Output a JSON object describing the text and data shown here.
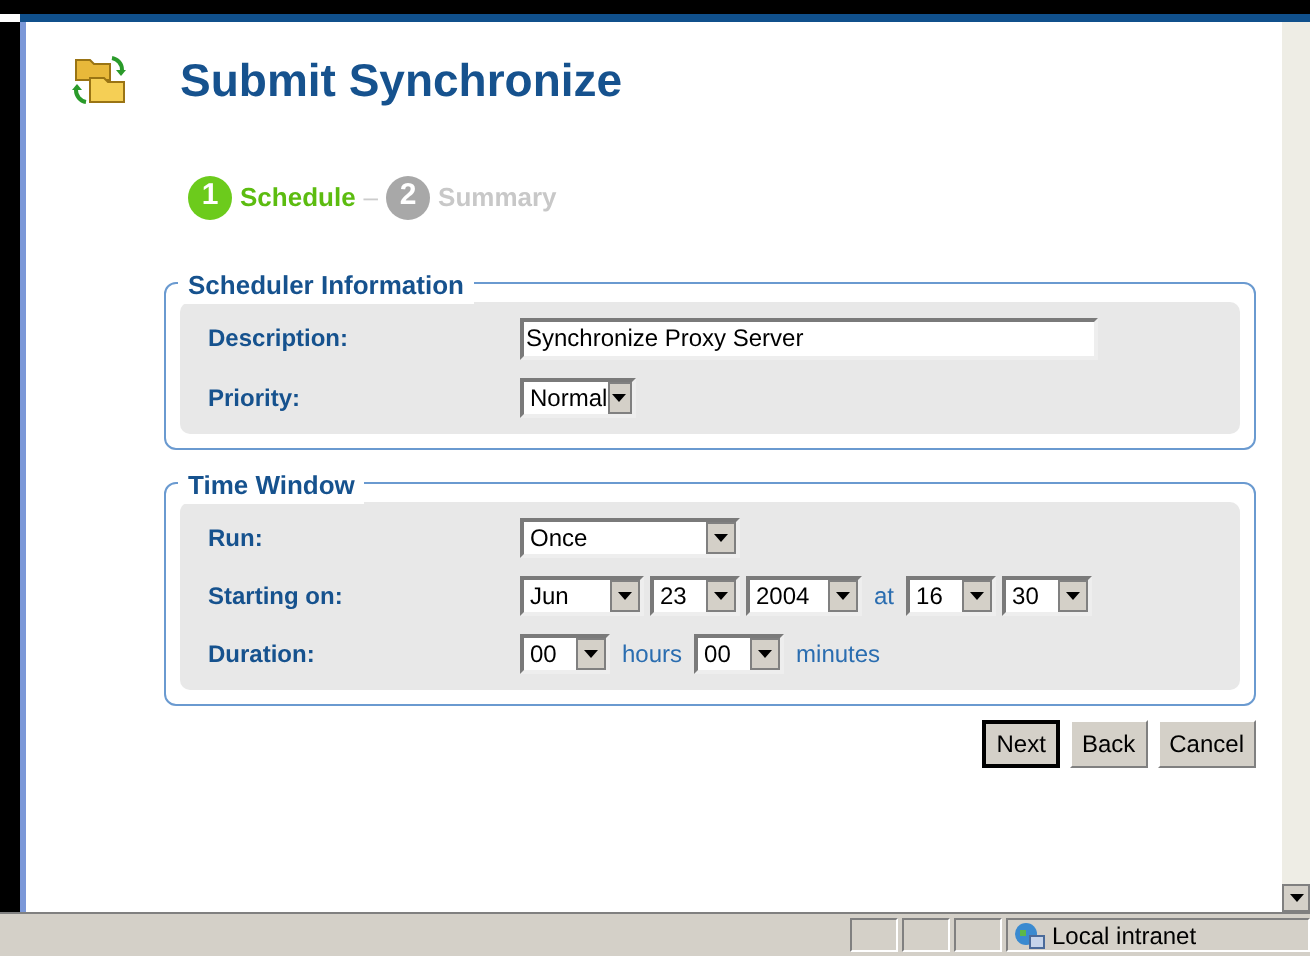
{
  "title": "Submit Synchronize",
  "steps": [
    {
      "number": "1",
      "label": "Schedule",
      "selected": true
    },
    {
      "number": "2",
      "label": "Summary",
      "selected": false
    }
  ],
  "step_separator": "–",
  "sections": [
    {
      "legend": "Scheduler Information",
      "rows": [
        {
          "label": "Description:",
          "controls": [
            {
              "kind": "text",
              "value": "Synchronize Proxy Server"
            }
          ]
        },
        {
          "label": "Priority:",
          "controls": [
            {
              "kind": "select",
              "value": "Normal"
            }
          ]
        }
      ]
    },
    {
      "legend": "Time Window",
      "rows": [
        {
          "label": "Run:",
          "controls": [
            {
              "kind": "select",
              "value": "Once"
            }
          ]
        },
        {
          "label": "Starting on:",
          "controls": [
            {
              "kind": "select",
              "value": "Jun"
            },
            {
              "kind": "select",
              "value": "23"
            },
            {
              "kind": "select",
              "value": "2004"
            },
            {
              "kind": "label",
              "value": "at"
            },
            {
              "kind": "select",
              "value": "16"
            },
            {
              "kind": "select",
              "value": "30"
            }
          ]
        },
        {
          "label": "Duration:",
          "controls": [
            {
              "kind": "select",
              "value": "00"
            },
            {
              "kind": "label",
              "value": "hours"
            },
            {
              "kind": "select",
              "value": "00"
            },
            {
              "kind": "label",
              "value": "minutes"
            }
          ]
        }
      ]
    }
  ],
  "buttons": [
    {
      "label": "Next",
      "default": true
    },
    {
      "label": "Back",
      "default": false
    },
    {
      "label": "Cancel",
      "default": false
    }
  ],
  "status_bar": {
    "zone": "Local intranet"
  }
}
